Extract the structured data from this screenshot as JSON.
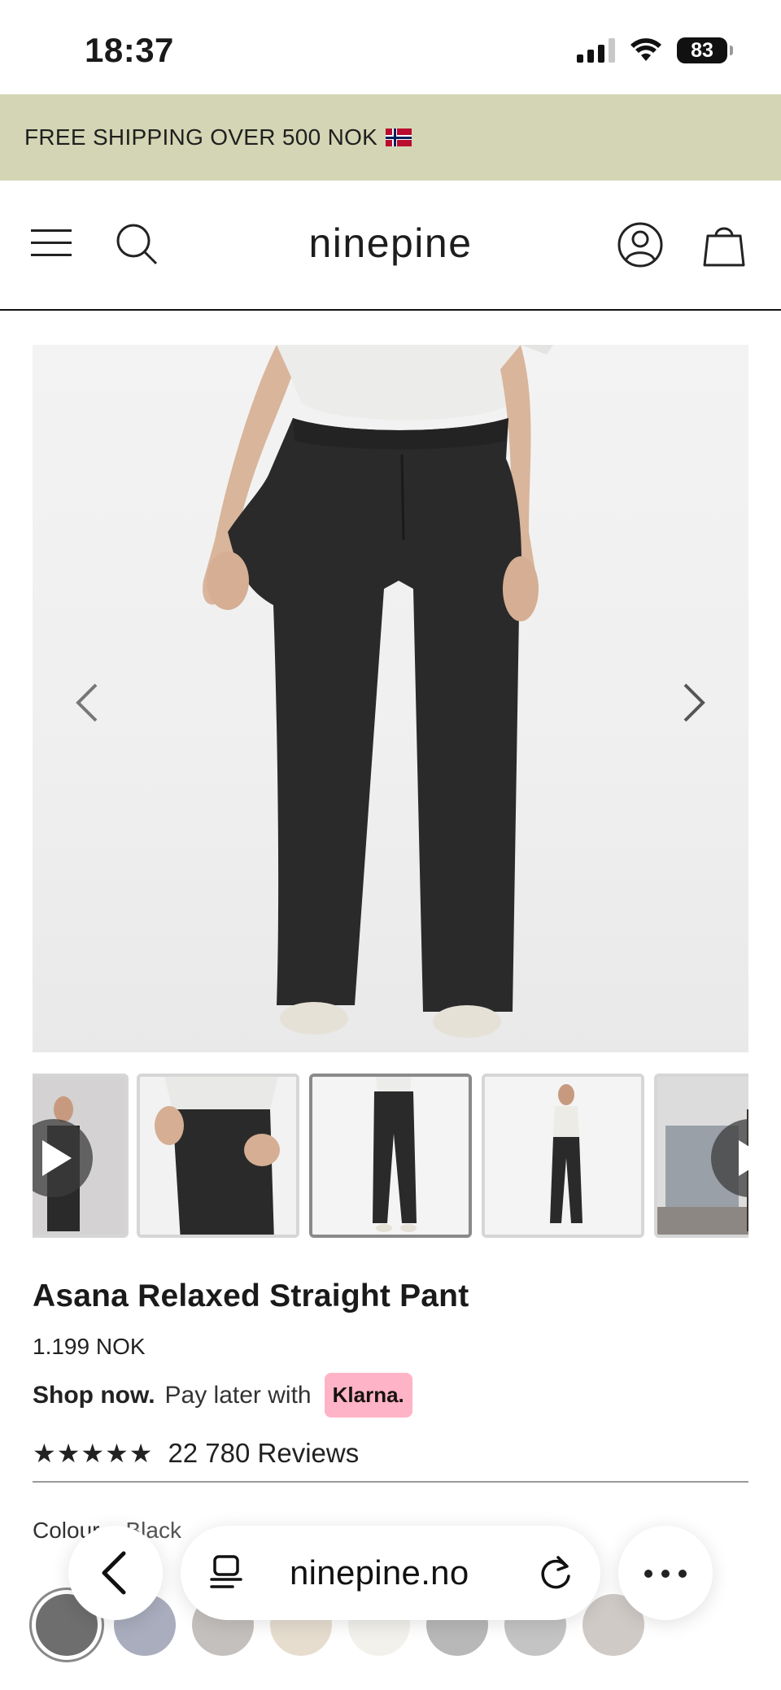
{
  "status_bar": {
    "time": "18:37",
    "battery": "83"
  },
  "promo": {
    "text": "FREE SHIPPING OVER 500 NOK"
  },
  "header": {
    "logo": "ninepine"
  },
  "gallery": {
    "thumbnails": [
      {
        "type": "video"
      },
      {
        "type": "image"
      },
      {
        "type": "image",
        "active": true
      },
      {
        "type": "image"
      },
      {
        "type": "video"
      }
    ]
  },
  "product": {
    "title": "Asana Relaxed Straight Pant",
    "price": "1.199 NOK",
    "klarna": {
      "lead": "Shop now.",
      "text": "Pay later with",
      "badge": "Klarna."
    },
    "rating_stars": "★★★★★",
    "reviews": "22 780 Reviews",
    "colour_label": "Colour",
    "colour_value": "Black"
  },
  "swatch_colors": [
    "#6e6e6e",
    "#a9adbd",
    "#c4c0bd",
    "#e6ddcf",
    "#f2f1ec",
    "#b8b8b8",
    "#c4c4c4",
    "#cfcac6"
  ],
  "browser": {
    "url": "ninepine.no"
  },
  "colors": {
    "promo_bg": "#d3d5b4",
    "klarna_pink": "#ffb3c7"
  }
}
